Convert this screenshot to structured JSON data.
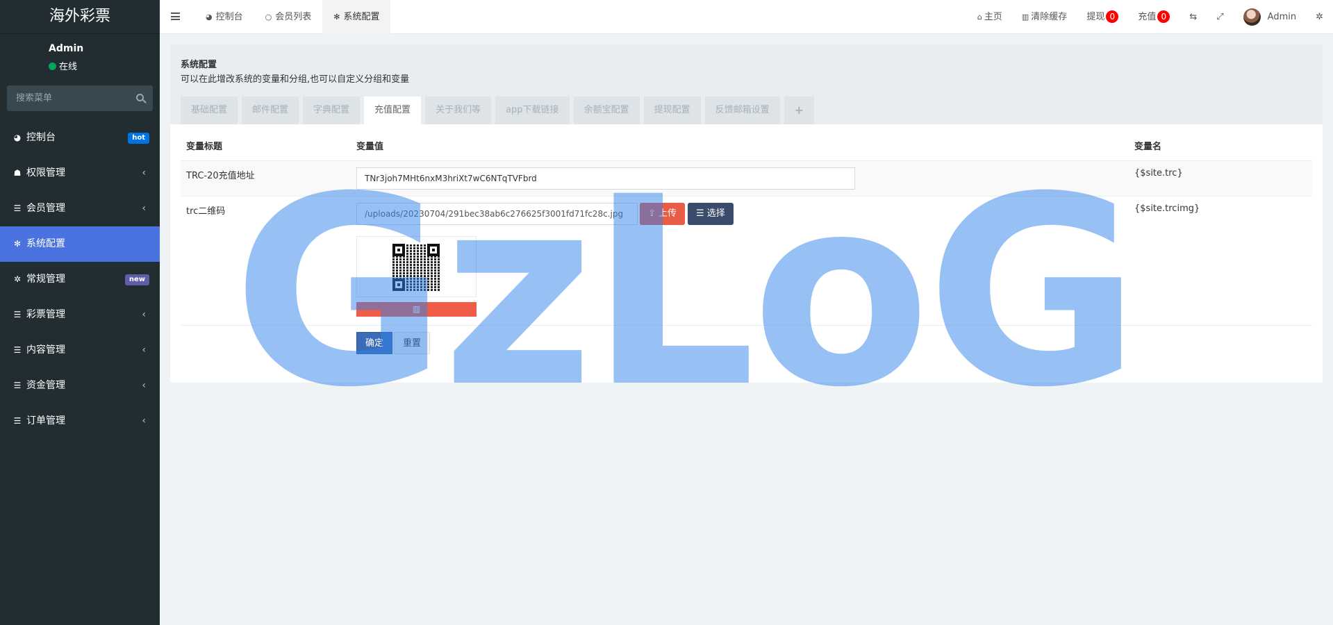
{
  "app": {
    "brand": "海外彩票"
  },
  "user": {
    "name": "Admin",
    "status": "在线"
  },
  "search": {
    "placeholder": "搜索菜单"
  },
  "menu": [
    {
      "label": "控制台",
      "icon": "dashboard-icon",
      "badge": "hot"
    },
    {
      "label": "权限管理",
      "icon": "users-icon",
      "arrow": "‹"
    },
    {
      "label": "会员管理",
      "icon": "list-icon",
      "arrow": "‹"
    },
    {
      "label": "系统配置",
      "icon": "cog-icon",
      "active": true
    },
    {
      "label": "常规管理",
      "icon": "cogs-icon",
      "badge": "new"
    },
    {
      "label": "彩票管理",
      "icon": "list-icon",
      "arrow": "‹"
    },
    {
      "label": "内容管理",
      "icon": "list-icon",
      "arrow": "‹"
    },
    {
      "label": "资金管理",
      "icon": "list-icon",
      "arrow": "‹"
    },
    {
      "label": "订单管理",
      "icon": "list-icon",
      "arrow": "‹"
    }
  ],
  "topbar": {
    "tabs": [
      {
        "label": "控制台",
        "icon": "dashboard-icon"
      },
      {
        "label": "会员列表",
        "icon": "circle-icon"
      },
      {
        "label": "系统配置",
        "icon": "cog-icon",
        "active": true
      }
    ],
    "home": "主页",
    "clear_cache": "清除缓存",
    "withdraw": "提现",
    "withdraw_count": "0",
    "recharge": "充值",
    "recharge_count": "0",
    "admin": "Admin"
  },
  "page": {
    "title": "系统配置",
    "description": "可以在此增改系统的变量和分组,也可以自定义分组和变量",
    "tabs": [
      "基础配置",
      "邮件配置",
      "字典配置",
      "充值配置",
      "关于我们等",
      "app下载链接",
      "余额宝配置",
      "提现配置",
      "反馈邮箱设置"
    ],
    "tab_add": "+",
    "active_tab": "充值配置"
  },
  "table": {
    "headers": {
      "title": "变量标题",
      "value": "变量值",
      "name": "变量名"
    },
    "rows": [
      {
        "title": "TRC-20充值地址",
        "value": "TNr3joh7MHt6nxM3hriXt7wC6NTqTVFbrd",
        "name": "{$site.trc}"
      },
      {
        "title": "trc二维码",
        "value": "/uploads/20230704/291bec38ab6c276625f3001fd71fc28c.jpg",
        "name": "{$site.trcimg}"
      }
    ],
    "upload_label": "上传",
    "choose_label": "选择"
  },
  "form": {
    "submit_label": "确定",
    "reset_label": "重置"
  },
  "watermark": "GzLoG",
  "colors": {
    "sidebar": "#222d32",
    "active": "#4a73df",
    "hot": "#0073e5",
    "new": "#605ca8",
    "danger": "#f05c46",
    "badge": "#ff0000"
  }
}
